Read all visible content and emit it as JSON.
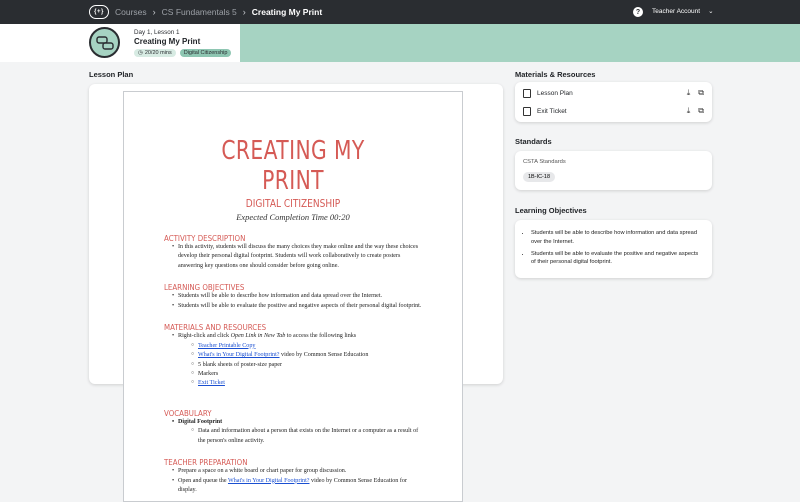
{
  "topbar": {
    "logo_text": "{+}",
    "breadcrumbs": [
      "Courses",
      "CS Fundamentals 5"
    ],
    "current": "Creating My Print",
    "separator": "›",
    "help_label": "?",
    "account_label": "Teacher Account",
    "account_chevron": "⌄"
  },
  "lesson": {
    "day": "Day 1, Lesson 1",
    "title": "Creating My Print",
    "duration": "20/20 mins",
    "category": "Digital Citizenship"
  },
  "lesson_plan": {
    "heading": "Lesson Plan",
    "doc": {
      "title": "CREATING MY PRINT",
      "subtitle": "DIGITAL CITIZENSHIP",
      "time": "Expected Completion Time 00:20",
      "activity_h": "ACTIVITY DESCRIPTION",
      "activity_p": "In this activity, students will discuss the many choices they make online and the way these choices develop their personal digital footprint. Students will work collaboratively to create posters answering key questions one should consider before going online.",
      "objectives_h": "LEARNING OBJECTIVES",
      "objectives": [
        "Students will be able to describe how information and data spread over the Internet.",
        "Students will be able to evaluate the positive and negative aspects of their personal digital footprint."
      ],
      "materials_h": "MATERIALS AND RESOURCES",
      "materials_intro_a": "Right-click and click ",
      "materials_intro_em": "Open Link in New Tab",
      "materials_intro_b": " to access the following links",
      "mat_link1": "Teacher Printable Copy",
      "mat_link2": "What's in Your Digital Footprint?",
      "mat_link2_rest": " video by Common Sense Education",
      "mat_3": "5 blank sheets of poster-size paper",
      "mat_4": "Markers",
      "mat_link5": "Exit Ticket",
      "vocab_h": "VOCABULARY",
      "vocab_term": "Digital Footprint",
      "vocab_def": "Data and information about a person that exists on the Internet or a computer as a result of the person's online activity.",
      "prep_h": "TEACHER PREPARATION",
      "prep_1": "Prepare a space on a white board or chart paper for group discussion.",
      "prep_2a": "Open and queue the ",
      "prep_2link": "What's in Your Digital Footprint?",
      "prep_2b": " video by Common Sense Education for display."
    }
  },
  "materials": {
    "heading": "Materials & Resources",
    "items": [
      "Lesson Plan",
      "Exit Ticket"
    ]
  },
  "standards": {
    "heading": "Standards",
    "label": "CSTA Standards",
    "pill": "1B-IC-18"
  },
  "objectives": {
    "heading": "Learning Objectives",
    "items": [
      "Students will be able to describe how information and data spread over the Internet.",
      "Students will be able to evaluate the positive and negative aspects of their personal digital footprint."
    ]
  }
}
